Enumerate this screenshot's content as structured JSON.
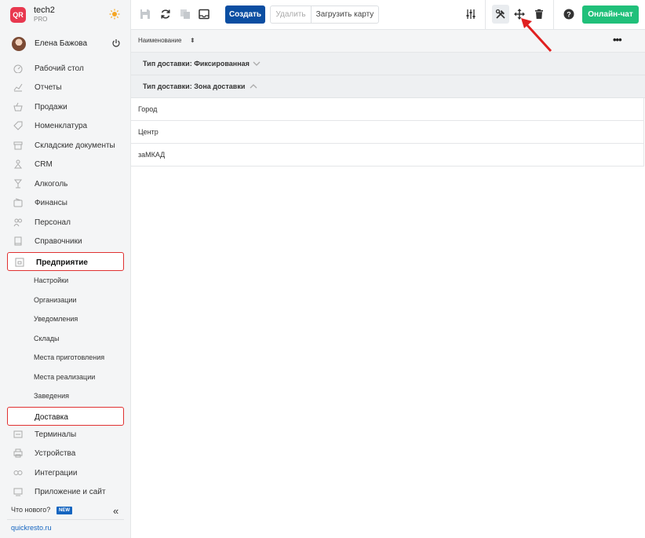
{
  "brand": {
    "name": "tech2",
    "plan": "PRO",
    "logo_text": "QR"
  },
  "user": {
    "name": "Елена Бажова"
  },
  "nav": {
    "items": [
      {
        "label": "Рабочий стол",
        "icon": "dashboard-icon"
      },
      {
        "label": "Отчеты",
        "icon": "reports-icon"
      },
      {
        "label": "Продажи",
        "icon": "basket-icon"
      },
      {
        "label": "Номенклатура",
        "icon": "tag-icon"
      },
      {
        "label": "Складские документы",
        "icon": "box-icon"
      },
      {
        "label": "CRM",
        "icon": "people-icon"
      },
      {
        "label": "Алкоголь",
        "icon": "glass-icon"
      },
      {
        "label": "Финансы",
        "icon": "wallet-icon"
      },
      {
        "label": "Персонал",
        "icon": "staff-icon"
      },
      {
        "label": "Справочники",
        "icon": "book-icon"
      },
      {
        "label": "Предприятие",
        "icon": "store-icon"
      }
    ],
    "sub_items": [
      {
        "label": "Настройки"
      },
      {
        "label": "Организации"
      },
      {
        "label": "Уведомления"
      },
      {
        "label": "Склады"
      },
      {
        "label": "Места приготовления"
      },
      {
        "label": "Места реализации"
      },
      {
        "label": "Заведения"
      },
      {
        "label": "Доставка"
      }
    ],
    "bottom_items": [
      {
        "label": "Терминалы",
        "icon": "terminal-icon"
      },
      {
        "label": "Устройства",
        "icon": "printer-icon"
      },
      {
        "label": "Интеграции",
        "icon": "link-icon"
      },
      {
        "label": "Приложение и сайт",
        "icon": "app-icon"
      }
    ]
  },
  "footer": {
    "whats_new": "Что нового?",
    "badge": "NEW",
    "site": "quickresto.ru"
  },
  "toolbar": {
    "create": "Создать",
    "delete": "Удалить",
    "upload_map": "Загрузить карту",
    "chat": "Онлайн-чат"
  },
  "table": {
    "column": "Наименование",
    "groups": [
      {
        "label": "Тип доставки: Фиксированная",
        "expanded": false
      },
      {
        "label": "Тип доставки: Зона доставки",
        "expanded": true
      }
    ],
    "rows": [
      "Город",
      "Центр",
      "заМКАД"
    ]
  },
  "colors": {
    "accent": "#0b4ea2",
    "chat": "#20c07a",
    "highlight": "#e03131",
    "logo": "#e8384f"
  }
}
